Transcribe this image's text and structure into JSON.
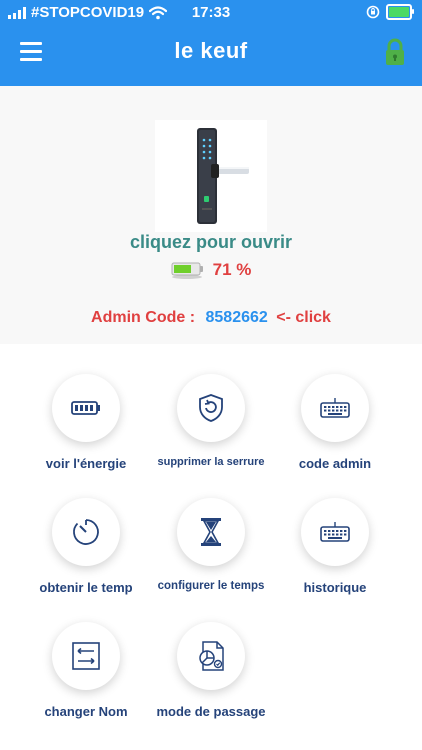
{
  "status_bar": {
    "carrier": "#STOPCOVID19",
    "time": "17:33"
  },
  "app_bar": {
    "title": "le keuf"
  },
  "hero": {
    "open_label": "cliquez pour ouvrir",
    "battery_level": "71 %",
    "battery_fraction": 0.71,
    "admin_label": "Admin Code :",
    "admin_code": "8582662",
    "admin_click": "<- click"
  },
  "actions": [
    {
      "label": "voir l'énergie",
      "icon": "battery-icon"
    },
    {
      "label": "supprimer la serrure",
      "icon": "reset-shield-icon"
    },
    {
      "label": "code admin",
      "icon": "keyboard-icon"
    },
    {
      "label": "obtenir le temp",
      "icon": "timer-icon"
    },
    {
      "label": "configurer le temps",
      "icon": "hourglass-icon"
    },
    {
      "label": "historique",
      "icon": "keyboard-history-icon"
    },
    {
      "label": "changer Nom",
      "icon": "rename-arrows-icon"
    },
    {
      "label": "mode de passage",
      "icon": "document-chart-icon"
    }
  ],
  "colors": {
    "primary": "#2a91ee",
    "accent_green": "#3a8b87",
    "alert_red": "#e04040",
    "label_navy": "#25437a"
  }
}
